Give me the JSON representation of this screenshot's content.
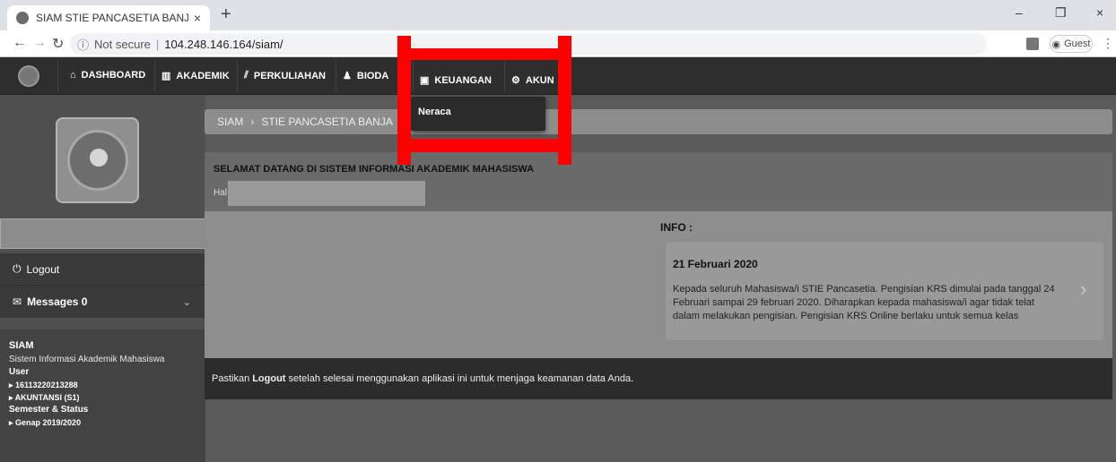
{
  "browser": {
    "tab_title": "SIAM STIE PANCASETIA BANJAR",
    "tab_close": "×",
    "new_tab": "+",
    "not_secure": "Not secure",
    "url": "104.248.146.164/siam/",
    "profile": "Guest",
    "window_controls": [
      "–",
      "❐",
      "×"
    ]
  },
  "navbar": {
    "items": [
      {
        "icon": "home-icon",
        "label": "DASHBOARD"
      },
      {
        "icon": "building-icon",
        "label": "AKADEMIK"
      },
      {
        "icon": "chart-icon",
        "label": "PERKULIAHAN"
      },
      {
        "icon": "user-icon",
        "label": "BIODA"
      },
      {
        "icon": "money-icon",
        "label": "KEUANGAN"
      },
      {
        "icon": "cogs-icon",
        "label": "AKUN"
      }
    ],
    "dropdown_item": "Neraca"
  },
  "sidebar": {
    "logout": "Logout",
    "messages": "Messages 0",
    "siam_title": "SIAM",
    "siam_subtitle": "Sistem Informasi Akademik Mahasiswa",
    "user_label": "User",
    "user_id": "▸ 16113220213288",
    "program": "▸ AKUNTANSI (S1)",
    "semester_label": "Semester & Status",
    "semester": "▸ Genap 2019/2020"
  },
  "main": {
    "breadcrumb": [
      "SIAM",
      "STIE PANCASETIA BANJA"
    ],
    "breadcrumb_sep": "›",
    "welcome_title": "SELAMAT DATANG DI SISTEM INFORMASI AKADEMIK MAHASISWA",
    "greeting": "Hal",
    "info_label": "INFO :",
    "info_date": "21 Februari 2020",
    "info_text": "Kepada seluruh Mahasiswa/i STIE Pancasetia. Pengisian KRS dimulai pada tanggal 24 Februari sampai 29 februari 2020. Diharapkan kepada mahasiswa/i agar tidak telat dalam melakukan pengisian. Pengisian KRS Online berlaku untuk semua kelas",
    "footer_pre": "Pastikan",
    "footer_bold": "Logout",
    "footer_post": "setelah selesai menggunakan aplikasi ini untuk menjaga keamanan data Anda."
  },
  "colors": {
    "highlight": "#ff0000",
    "navbar": "#2e2e2e"
  }
}
